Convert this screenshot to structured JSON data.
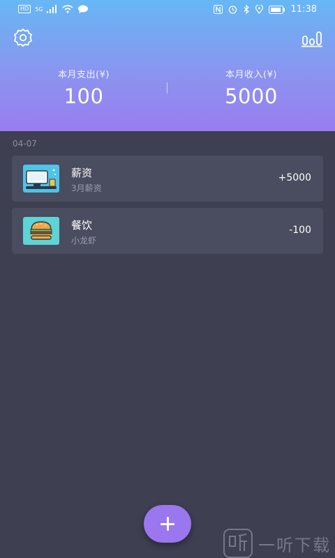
{
  "status_bar": {
    "network_badge": "HD",
    "signal_label": "5G",
    "time": "11:38"
  },
  "header": {
    "expense": {
      "label": "本月支出(¥)",
      "value": "100"
    },
    "income": {
      "label": "本月收入(¥)",
      "value": "5000"
    }
  },
  "date_group": "04-07",
  "records": [
    {
      "title": "薪资",
      "note": "3月薪资",
      "amount": "+5000",
      "icon": "salary-icon",
      "icon_bg": "#4fc3e8"
    },
    {
      "title": "餐饮",
      "note": "小龙虾",
      "amount": "-100",
      "icon": "burger-icon",
      "icon_bg": "#5ed4d6"
    }
  ],
  "watermark": {
    "text": "一听下载"
  },
  "colors": {
    "header_top": "#66b7f5",
    "header_bottom": "#9a7cf0",
    "background": "#3e3f51",
    "card": "#4a4c5f",
    "fab": "#9a76ef"
  }
}
